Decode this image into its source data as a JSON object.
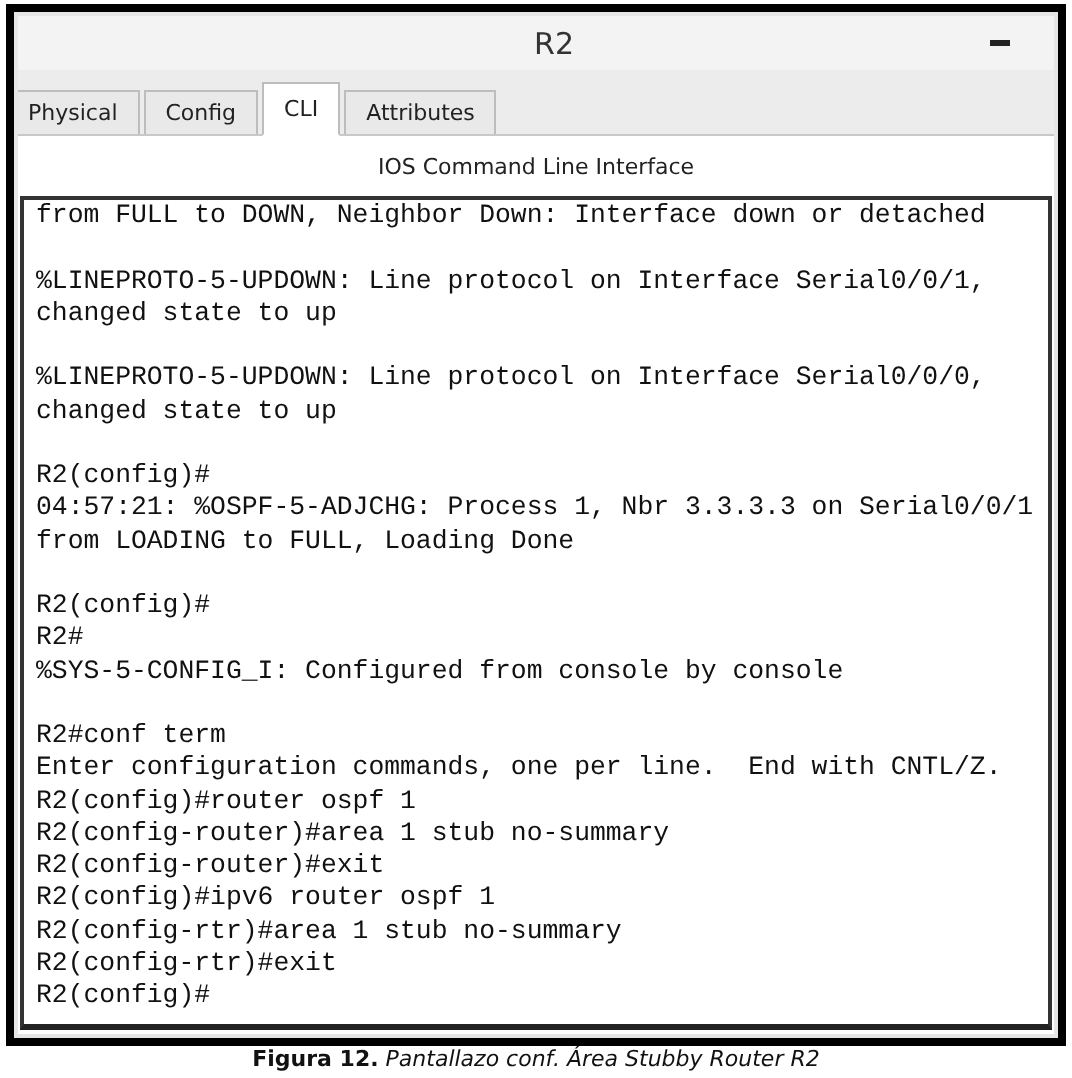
{
  "window": {
    "title": "R2"
  },
  "tabs": [
    {
      "label": "Physical",
      "selected": false
    },
    {
      "label": "Config",
      "selected": false
    },
    {
      "label": "CLI",
      "selected": true
    },
    {
      "label": "Attributes",
      "selected": false
    }
  ],
  "panel": {
    "heading": "IOS Command Line Interface"
  },
  "console": {
    "blocks": [
      [
        "from FULL to DOWN, Neighbor Down: Interface down or detached"
      ],
      [
        "%LINEPROTO-5-UPDOWN: Line protocol on Interface Serial0/0/1,",
        "changed state to up"
      ],
      [
        "%LINEPROTO-5-UPDOWN: Line protocol on Interface Serial0/0/0,",
        "changed state to up"
      ],
      [
        "R2(config)#",
        "04:57:21: %OSPF-5-ADJCHG: Process 1, Nbr 3.3.3.3 on Serial0/0/1",
        "from LOADING to FULL, Loading Done"
      ],
      [
        "R2(config)#",
        "R2#",
        "%SYS-5-CONFIG_I: Configured from console by console"
      ],
      [
        "R2#conf term",
        "Enter configuration commands, one per line.  End with CNTL/Z.",
        "R2(config)#router ospf 1",
        "R2(config-router)#area 1 stub no-summary",
        "R2(config-router)#exit",
        "R2(config)#ipv6 router ospf 1",
        "R2(config-rtr)#area 1 stub no-summary",
        "R2(config-rtr)#exit",
        "R2(config)#"
      ]
    ]
  },
  "caption": {
    "label": "Figura 12.",
    "text": "Pantallazo conf. Área Stubby Router R2"
  }
}
